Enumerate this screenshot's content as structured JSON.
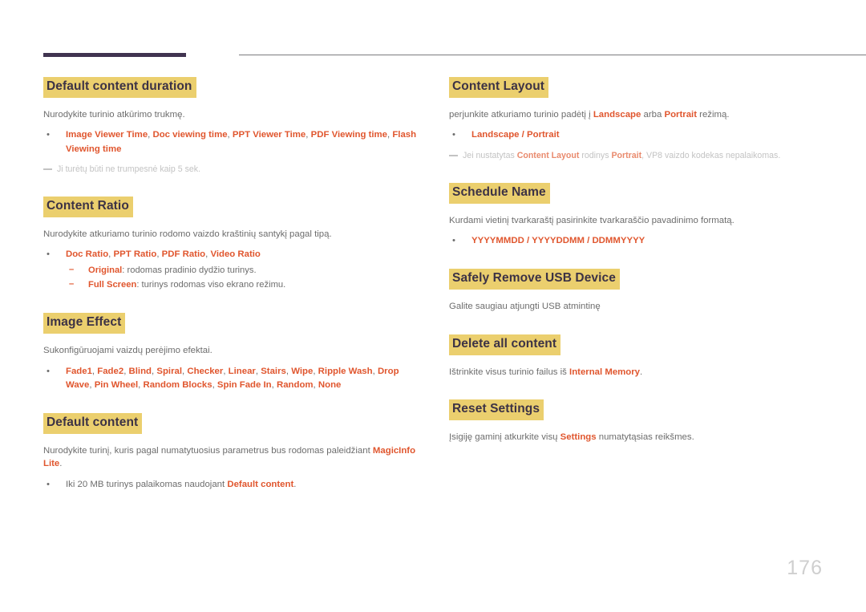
{
  "theme": {
    "accent": "#e0562e",
    "highlight": "#ebcf6e",
    "heading_text": "#3c3245",
    "body_text": "#6d6d6d",
    "note_text": "#c3c3c3",
    "rule_thick": "#403450",
    "rule_thin": "#7b7b7f",
    "page_number_color": "#cfcfcf"
  },
  "page": {
    "number": "176"
  },
  "left_column": {
    "sections": [
      {
        "heading": "Default content duration",
        "body": "Nurodykite turinio atkūrimo trukmę.",
        "bullets": [
          {
            "marker": "•",
            "parts": [
              {
                "text": "Image Viewer Time",
                "style": "accent"
              },
              {
                "text": ", ",
                "style": "plain"
              },
              {
                "text": "Doc viewing time",
                "style": "accent"
              },
              {
                "text": ", ",
                "style": "plain"
              },
              {
                "text": "PPT Viewer Time",
                "style": "accent"
              },
              {
                "text": ", ",
                "style": "plain"
              },
              {
                "text": "PDF Viewing time",
                "style": "accent"
              },
              {
                "text": ", ",
                "style": "plain"
              },
              {
                "text": "Flash Viewing time",
                "style": "accent"
              }
            ]
          }
        ],
        "note": "Ji turėtų būti ne trumpesnė kaip 5 sek."
      },
      {
        "heading": "Content Ratio",
        "body": "Nurodykite atkuriamo turinio rodomo vaizdo kraštinių santykį pagal tipą.",
        "bullets": [
          {
            "marker": "•",
            "parts": [
              {
                "text": "Doc Ratio",
                "style": "accent"
              },
              {
                "text": ", ",
                "style": "plain"
              },
              {
                "text": "PPT Ratio",
                "style": "accent"
              },
              {
                "text": ", ",
                "style": "plain"
              },
              {
                "text": "PDF Ratio",
                "style": "accent"
              },
              {
                "text": ", ",
                "style": "plain"
              },
              {
                "text": "Video Ratio",
                "style": "accent"
              }
            ],
            "subbullets": [
              {
                "marker": "–",
                "parts": [
                  {
                    "text": "Original",
                    "style": "accent"
                  },
                  {
                    "text": ": rodomas pradinio dydžio turinys.",
                    "style": "plain"
                  }
                ]
              },
              {
                "marker": "–",
                "parts": [
                  {
                    "text": "Full Screen",
                    "style": "accent"
                  },
                  {
                    "text": ": turinys rodomas viso ekrano režimu.",
                    "style": "plain"
                  }
                ]
              }
            ]
          }
        ]
      },
      {
        "heading": "Image Effect",
        "body": "Sukonfigūruojami vaizdų perėjimo efektai.",
        "bullets": [
          {
            "marker": "•",
            "parts": [
              {
                "text": "Fade1",
                "style": "accent"
              },
              {
                "text": ", ",
                "style": "plain"
              },
              {
                "text": "Fade2",
                "style": "accent"
              },
              {
                "text": ", ",
                "style": "plain"
              },
              {
                "text": "Blind",
                "style": "accent"
              },
              {
                "text": ", ",
                "style": "plain"
              },
              {
                "text": "Spiral",
                "style": "accent"
              },
              {
                "text": ", ",
                "style": "plain"
              },
              {
                "text": "Checker",
                "style": "accent"
              },
              {
                "text": ", ",
                "style": "plain"
              },
              {
                "text": "Linear",
                "style": "accent"
              },
              {
                "text": ", ",
                "style": "plain"
              },
              {
                "text": "Stairs",
                "style": "accent"
              },
              {
                "text": ", ",
                "style": "plain"
              },
              {
                "text": "Wipe",
                "style": "accent"
              },
              {
                "text": ", ",
                "style": "plain"
              },
              {
                "text": "Ripple Wash",
                "style": "accent"
              },
              {
                "text": ", ",
                "style": "plain"
              },
              {
                "text": "Drop Wave",
                "style": "accent"
              },
              {
                "text": ", ",
                "style": "plain"
              },
              {
                "text": "Pin Wheel",
                "style": "accent"
              },
              {
                "text": ", ",
                "style": "plain"
              },
              {
                "text": "Random Blocks",
                "style": "accent"
              },
              {
                "text": ", ",
                "style": "plain"
              },
              {
                "text": "Spin Fade In",
                "style": "accent"
              },
              {
                "text": ", ",
                "style": "plain"
              },
              {
                "text": "Random",
                "style": "accent"
              },
              {
                "text": ", ",
                "style": "plain"
              },
              {
                "text": "None",
                "style": "accent"
              }
            ]
          }
        ]
      },
      {
        "heading": "Default content",
        "body_parts": [
          {
            "text": "Nurodykite turinį, kuris pagal numatytuosius parametrus bus rodomas paleidžiant ",
            "style": "plain"
          },
          {
            "text": "MagicInfo Lite",
            "style": "accent"
          },
          {
            "text": ".",
            "style": "plain"
          }
        ],
        "bullets": [
          {
            "marker": "•",
            "parts": [
              {
                "text": "Iki 20 MB turinys palaikomas naudojant ",
                "style": "plain"
              },
              {
                "text": "Default content",
                "style": "accent"
              },
              {
                "text": ".",
                "style": "plain"
              }
            ]
          }
        ]
      }
    ]
  },
  "right_column": {
    "sections": [
      {
        "heading": "Content Layout",
        "body_parts": [
          {
            "text": "perjunkite atkuriamo turinio padėtį į ",
            "style": "plain"
          },
          {
            "text": "Landscape",
            "style": "accent"
          },
          {
            "text": " arba ",
            "style": "plain"
          },
          {
            "text": "Portrait",
            "style": "accent"
          },
          {
            "text": " režimą.",
            "style": "plain"
          }
        ],
        "bullets": [
          {
            "marker": "•",
            "parts": [
              {
                "text": "Landscape",
                "style": "accent"
              },
              {
                "text": " / ",
                "style": "accent"
              },
              {
                "text": "Portrait",
                "style": "accent"
              }
            ]
          }
        ],
        "note_parts": [
          {
            "text": "Jei nustatytas ",
            "style": "plain"
          },
          {
            "text": "Content Layout",
            "style": "accent"
          },
          {
            "text": " rodinys ",
            "style": "plain"
          },
          {
            "text": "Portrait",
            "style": "accent"
          },
          {
            "text": ", VP8 vaizdo kodekas nepalaikomas.",
            "style": "plain"
          }
        ]
      },
      {
        "heading": "Schedule Name",
        "body": "Kurdami vietinį tvarkaraštį pasirinkite tvarkaraščio pavadinimo formatą.",
        "bullets": [
          {
            "marker": "•",
            "parts": [
              {
                "text": "YYYYMMDD",
                "style": "accent"
              },
              {
                "text": " / ",
                "style": "accent"
              },
              {
                "text": "YYYYDDMM",
                "style": "accent"
              },
              {
                "text": " / ",
                "style": "accent"
              },
              {
                "text": "DDMMYYYY",
                "style": "accent"
              }
            ]
          }
        ]
      },
      {
        "heading": "Safely Remove USB Device",
        "body": "Galite saugiau atjungti USB atmintinę"
      },
      {
        "heading": "Delete all content",
        "body_parts": [
          {
            "text": "Ištrinkite visus turinio failus iš ",
            "style": "plain"
          },
          {
            "text": "Internal Memory",
            "style": "accent"
          },
          {
            "text": ".",
            "style": "plain"
          }
        ]
      },
      {
        "heading": "Reset Settings",
        "body_parts": [
          {
            "text": "Įsigiję gaminį atkurkite visų ",
            "style": "plain"
          },
          {
            "text": "Settings",
            "style": "accent"
          },
          {
            "text": " numatytąsias reikšmes.",
            "style": "plain"
          }
        ]
      }
    ]
  }
}
